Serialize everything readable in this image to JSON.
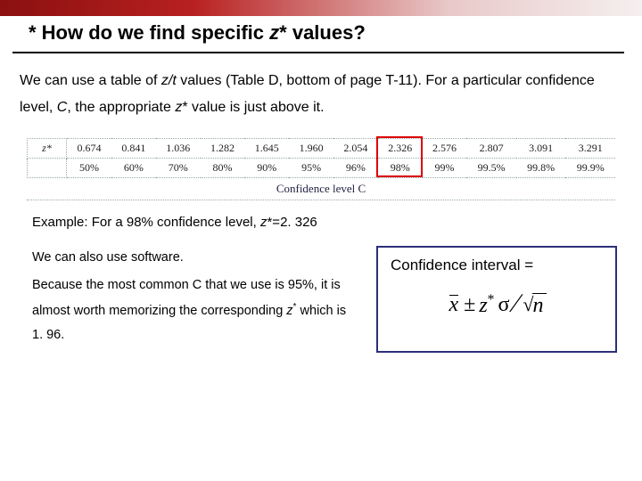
{
  "heading": {
    "prefix": "* How do we find specific ",
    "z": "z",
    "suffix": "* values?"
  },
  "para": {
    "t1": "We can use a table of ",
    "zt": "z/t",
    "t2": " values (Table D, bottom of page T-11). For a particular confidence level, ",
    "C": "C",
    "t3": ", the appropriate ",
    "z": "z",
    "t4": "* value is just above it."
  },
  "chart_data": {
    "type": "table",
    "row_label_z": "z*",
    "row_label_c": "",
    "z_values": [
      "0.674",
      "0.841",
      "1.036",
      "1.282",
      "1.645",
      "1.960",
      "2.054",
      "2.326",
      "2.576",
      "2.807",
      "3.091",
      "3.291"
    ],
    "c_values": [
      "50%",
      "60%",
      "70%",
      "80%",
      "90%",
      "95%",
      "96%",
      "98%",
      "99%",
      "99.5%",
      "99.8%",
      "99.9%"
    ],
    "highlight_index": 7,
    "caption": "Confidence level C"
  },
  "example": {
    "t1": "Example: For a 98% confidence level, ",
    "z": "z",
    "t2": "*=2. 326"
  },
  "leftblock": {
    "p1": "We can also use software.",
    "p2a": "Because the most common C that we use is 95%, it is almost worth memorizing the corresponding ",
    "p2z": "z",
    "p2star": "*",
    "p2b": " which is 1. 96."
  },
  "rightblock": {
    "label": "Confidence interval =",
    "formula": {
      "x": "x",
      "pm": "±",
      "z": "z",
      "star": "*",
      "sigma": "σ",
      "n": "n"
    }
  }
}
